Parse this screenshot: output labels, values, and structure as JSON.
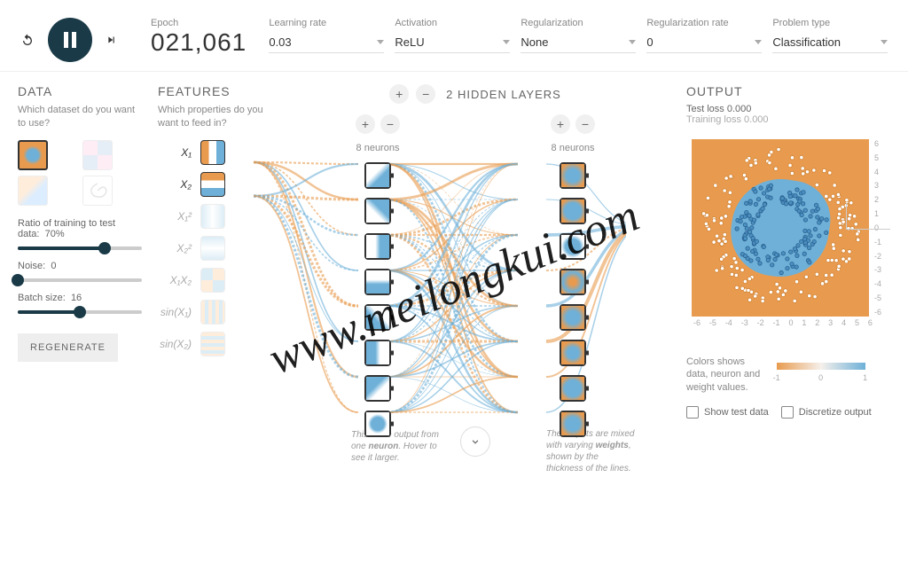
{
  "topbar": {
    "epoch_label": "Epoch",
    "epoch_value": "021,061",
    "learning_rate": {
      "label": "Learning rate",
      "value": "0.03"
    },
    "activation": {
      "label": "Activation",
      "value": "ReLU"
    },
    "regularization": {
      "label": "Regularization",
      "value": "None"
    },
    "regularization_rate": {
      "label": "Regularization rate",
      "value": "0"
    },
    "problem_type": {
      "label": "Problem type",
      "value": "Classification"
    }
  },
  "data_panel": {
    "title": "DATA",
    "subtitle": "Which dataset do you want to use?",
    "ratio_label": "Ratio of training to test data:",
    "ratio_value": "70%",
    "noise_label": "Noise:",
    "noise_value": "0",
    "batch_label": "Batch size:",
    "batch_value": "16",
    "regenerate": "REGENERATE"
  },
  "features_panel": {
    "title": "FEATURES",
    "subtitle": "Which properties do you want to feed in?",
    "items": [
      {
        "label": "X₁",
        "active": true
      },
      {
        "label": "X₂",
        "active": true
      },
      {
        "label": "X₁²",
        "active": false
      },
      {
        "label": "X₂²",
        "active": false
      },
      {
        "label": "X₁X₂",
        "active": false
      },
      {
        "label": "sin(X₁)",
        "active": false
      },
      {
        "label": "sin(X₂)",
        "active": false
      }
    ]
  },
  "network": {
    "hidden_layers_count": "2",
    "hidden_layers_label": "HIDDEN LAYERS",
    "layer1_count": "8 neurons",
    "layer2_count": "8 neurons",
    "annotation1": "This is the output from one neuron. Hover to see it larger.",
    "annotation2": "The outputs are mixed with varying weights, shown by the thickness of the lines."
  },
  "output_panel": {
    "title": "OUTPUT",
    "test_loss_label": "Test loss",
    "test_loss_value": "0.000",
    "train_loss_label": "Training loss",
    "train_loss_value": "0.000",
    "axis_ticks": [
      "-6",
      "-5",
      "-4",
      "-3",
      "-2",
      "-1",
      "0",
      "1",
      "2",
      "3",
      "4",
      "5",
      "6"
    ],
    "legend_text": "Colors shows data, neuron and weight values.",
    "colorbar_ticks": [
      "-1",
      "0",
      "1"
    ],
    "show_test": "Show test data",
    "discretize": "Discretize output"
  },
  "watermark": "www.meilongkui.com"
}
